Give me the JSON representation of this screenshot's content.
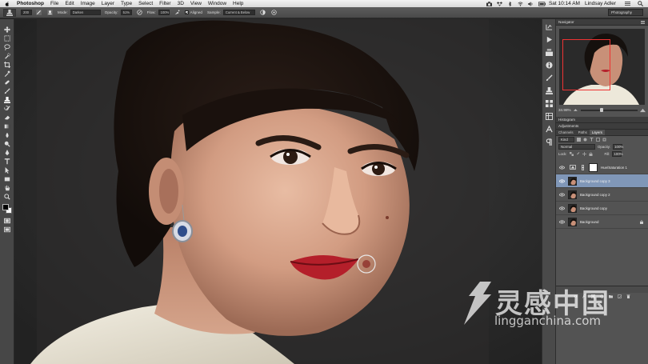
{
  "menubar": {
    "app_name": "Photoshop",
    "items": [
      "File",
      "Edit",
      "Image",
      "Layer",
      "Type",
      "Select",
      "Filter",
      "3D",
      "View",
      "Window",
      "Help"
    ],
    "clock": "Sat 10:14 AM",
    "user": "Lindsay Adler"
  },
  "options_bar": {
    "brush_size": "200",
    "mode_label": "Mode:",
    "mode_value": "Darken",
    "opacity_label": "Opacity:",
    "opacity_value": "51%",
    "flow_label": "Flow:",
    "flow_value": "100%",
    "aligned_label": "Aligned",
    "sample_label": "Sample:",
    "sample_value": "Current & Below",
    "workspace": "Photography"
  },
  "panels": {
    "navigator_title": "Navigator",
    "zoom_value": "34.98%",
    "histogram_title": "Histogram",
    "adjustments_title": "Adjustments",
    "tabs": [
      "Channels",
      "Paths",
      "Layers"
    ],
    "active_tab": "Layers",
    "kind_label": "Kind",
    "blend_mode": "Normal",
    "opacity_label": "Opacity:",
    "opacity_value": "100%",
    "lock_label": "Lock:",
    "fill_label": "Fill:",
    "fill_value": "100%",
    "layers": [
      {
        "name": "Hue/Saturation 1",
        "type": "adjustment",
        "selected": false
      },
      {
        "name": "Background copy 3",
        "type": "pixel",
        "selected": true
      },
      {
        "name": "Background copy 2",
        "type": "pixel",
        "selected": false
      },
      {
        "name": "Background copy",
        "type": "pixel",
        "selected": false
      },
      {
        "name": "Background",
        "type": "pixel",
        "selected": false,
        "locked": true
      }
    ]
  },
  "watermark": {
    "chinese": "灵感中国",
    "url": "lingganchina.com"
  },
  "colors": {
    "selected_layer": "#8097b8",
    "panel_bg": "#535353",
    "canvas_bg": "#2b2b2b",
    "navigator_frame": "#ee3333"
  }
}
